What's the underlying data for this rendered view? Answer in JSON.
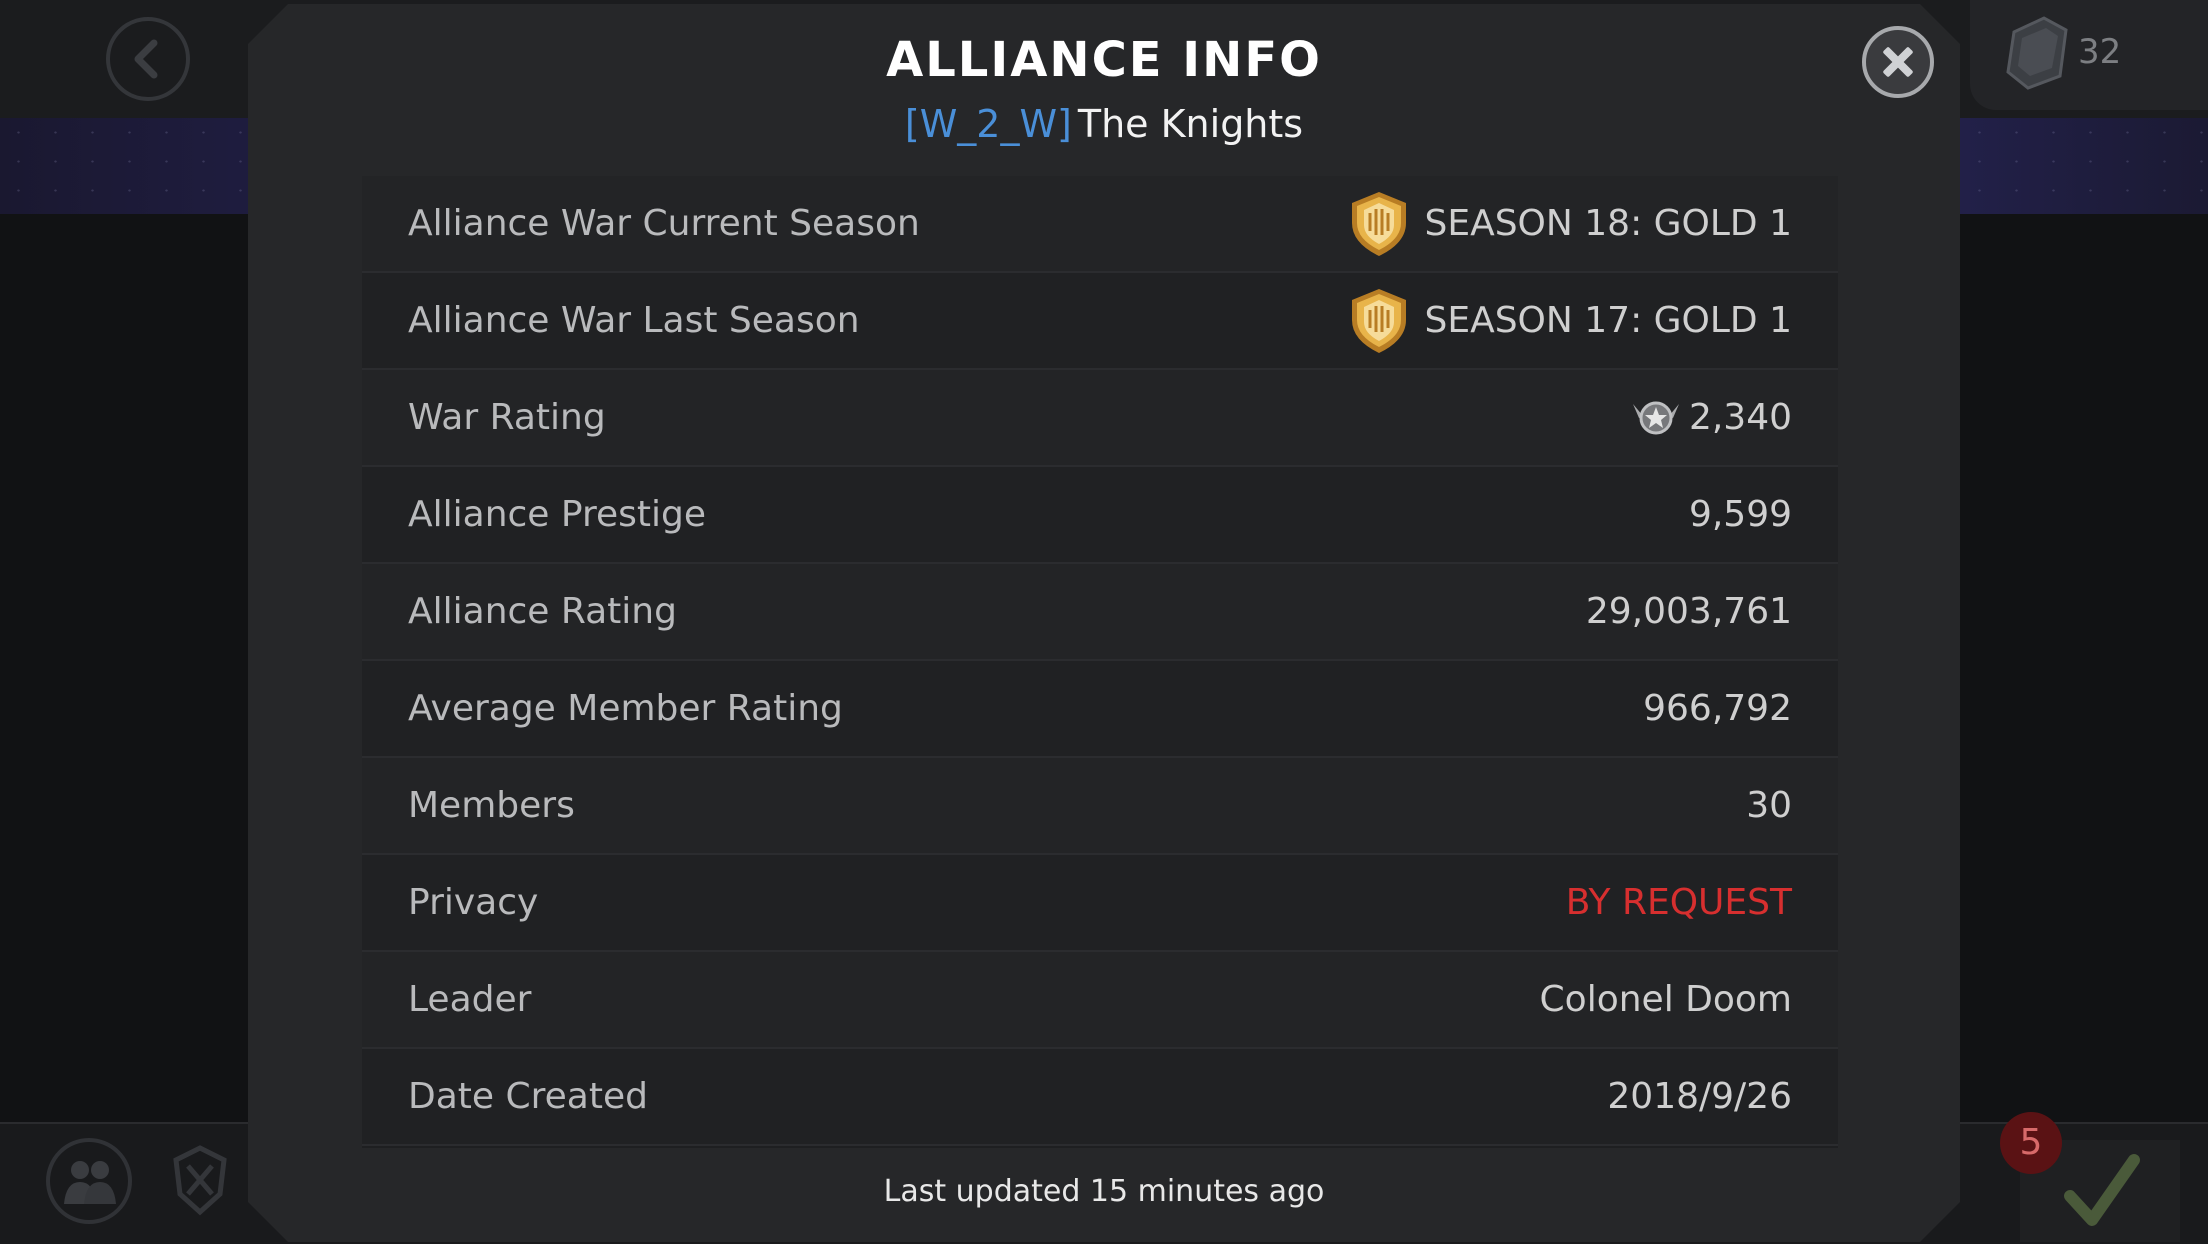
{
  "background": {
    "resource_count": "32",
    "notification_count": "5"
  },
  "modal": {
    "title": "ALLIANCE INFO",
    "alliance_tag": "[W_2_W]",
    "alliance_name": "The Knights",
    "rows": [
      {
        "label": "Alliance War Current Season",
        "value": "SEASON 18: GOLD 1",
        "icon": "gold-shield-icon"
      },
      {
        "label": "Alliance War Last Season",
        "value": "SEASON 17: GOLD 1",
        "icon": "gold-shield-icon"
      },
      {
        "label": "War Rating",
        "value": "2,340",
        "icon": "war-rating-emblem-icon"
      },
      {
        "label": "Alliance Prestige",
        "value": "9,599"
      },
      {
        "label": "Alliance Rating",
        "value": "29,003,761"
      },
      {
        "label": "Average Member Rating",
        "value": "966,792"
      },
      {
        "label": "Members",
        "value": "30"
      },
      {
        "label": "Privacy",
        "value": "BY REQUEST",
        "color": "#d72f2f"
      },
      {
        "label": "Leader",
        "value": "Colonel Doom"
      },
      {
        "label": "Date Created",
        "value": "2018/9/26"
      }
    ],
    "footer": "Last updated 15 minutes ago"
  },
  "colors": {
    "tag_blue": "#4a8fd8",
    "privacy_red": "#d72f2f",
    "gold": "#e0a83a"
  }
}
